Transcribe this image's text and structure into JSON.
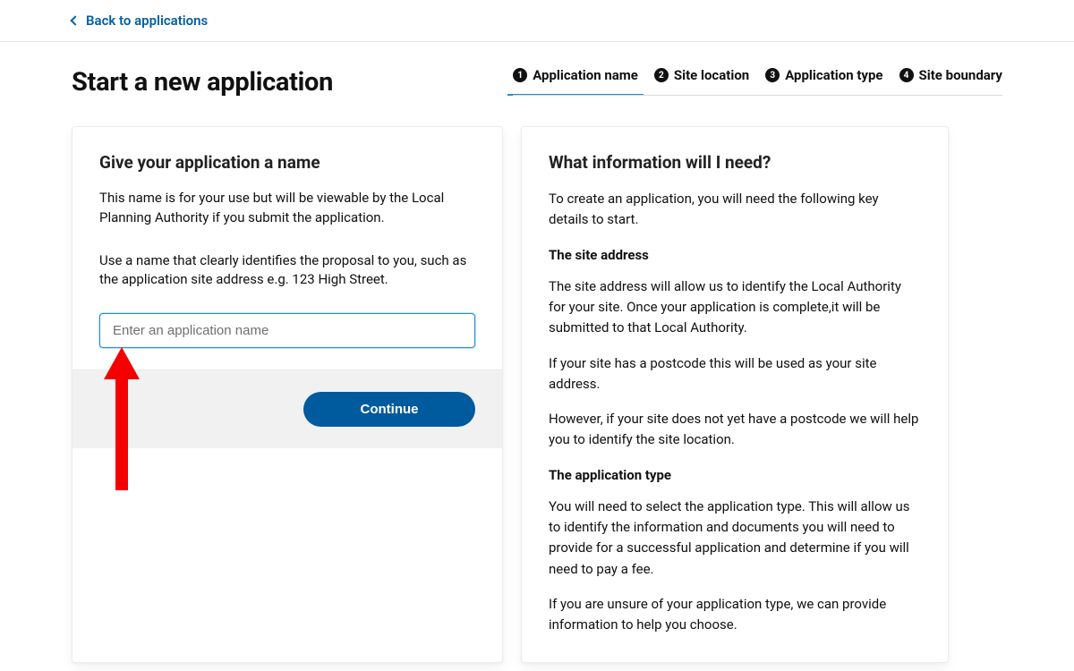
{
  "nav": {
    "back_label": "Back to applications"
  },
  "header": {
    "title": "Start a new application"
  },
  "steps": [
    {
      "num": "1",
      "label": "Application name",
      "active": true
    },
    {
      "num": "2",
      "label": "Site location",
      "active": false
    },
    {
      "num": "3",
      "label": "Application type",
      "active": false
    },
    {
      "num": "4",
      "label": "Site boundary",
      "active": false
    }
  ],
  "form": {
    "heading": "Give your application a name",
    "desc1": "This name is for your use but will be viewable by the Local Planning Authority if you submit the application.",
    "desc2": "Use a name that clearly identifies the proposal to you, such as the application site address e.g. 123 High Street.",
    "placeholder": "Enter an application name",
    "continue_label": "Continue"
  },
  "info": {
    "heading": "What information will I need?",
    "intro": "To create an application, you will need the following key details to start.",
    "sub1_title": "The site address",
    "sub1_p1": "The site address will allow us to identify the Local Authority for your site. Once your application is complete,it will be submitted to that Local Authority.",
    "sub1_p2": "If your site has a postcode this will be used as your site address.",
    "sub1_p3": "However, if your site does not yet have a postcode we will help you to identify the site location.",
    "sub2_title": "The application type",
    "sub2_p1": "You will need to select the application type. This will allow us to identify the information and documents you will need to provide for a successful application and determine if you will need to pay a fee.",
    "sub2_p2": "If you are unsure of your application type, we can provide information to help you choose."
  }
}
